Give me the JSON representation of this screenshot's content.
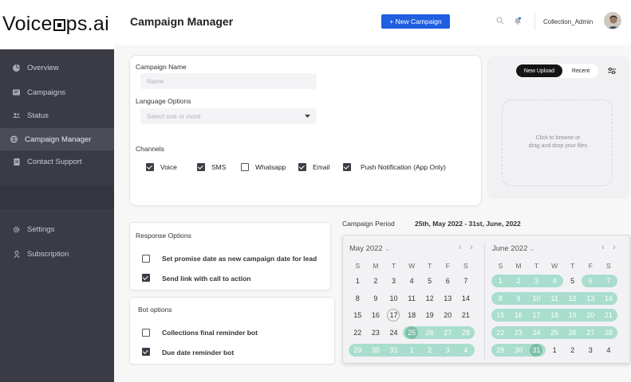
{
  "app": {
    "logo": "Voice▣ps.ai",
    "logo_left": "Voice",
    "logo_right": "ps.ai"
  },
  "sidebar": {
    "items": [
      {
        "label": "Overview",
        "icon": "pie-chart-icon"
      },
      {
        "label": "Campaigns",
        "icon": "campaign-icon"
      },
      {
        "label": "Status",
        "icon": "users-icon"
      },
      {
        "label": "Campaign Manager",
        "icon": "globe-icon",
        "active": true
      },
      {
        "label": "Contact Support",
        "icon": "document-icon"
      },
      {
        "label": "Settings",
        "icon": "gear-icon"
      },
      {
        "label": "Subscription",
        "icon": "user-icon"
      }
    ]
  },
  "header": {
    "title": "Campaign Manager",
    "new_campaign_label": "+ New Campaign",
    "user_name": "Collection_Admin"
  },
  "form": {
    "campaign_name_label": "Campaign Name",
    "name_placeholder": "Name",
    "language_label": "Language Options",
    "language_placeholder": "Select one or more",
    "channels_label": "Channels",
    "channels": [
      {
        "label": "Voice",
        "checked": true
      },
      {
        "label": "SMS",
        "checked": true
      },
      {
        "label": "Whatsapp",
        "checked": false
      },
      {
        "label": "Email",
        "checked": true
      },
      {
        "label": "Push Notification (App Only)",
        "checked": true
      }
    ]
  },
  "upload": {
    "tab_new": "New Upload",
    "tab_recent": "Recent",
    "drop_line1": "Click to browse or",
    "drop_line2": "drag and drop your files"
  },
  "response": {
    "title": "Response Options",
    "options": [
      {
        "label": "Set promise date as new campaign date for lead",
        "checked": false
      },
      {
        "label": "Send link with call to action",
        "checked": true
      }
    ]
  },
  "bot": {
    "title": "Bot options",
    "options": [
      {
        "label": "Collections final reminder bot",
        "checked": false
      },
      {
        "label": "Due date reminder bot",
        "checked": true
      }
    ]
  },
  "campaign_period": {
    "label": "Campaign Period",
    "value": "25th, May 2022 - 31st, June, 2022"
  },
  "calendar": {
    "weekdays": [
      "S",
      "M",
      "T",
      "W",
      "T",
      "F",
      "S"
    ],
    "months": [
      {
        "title": "May 2022",
        "rows": [
          [
            "1",
            "2",
            "3",
            "4",
            "5",
            "6",
            "7"
          ],
          [
            "8",
            "9",
            "10",
            "11",
            "12",
            "13",
            "14"
          ],
          [
            "15",
            "16",
            "17",
            "18",
            "19",
            "20",
            "21"
          ],
          [
            "22",
            "23",
            "24",
            "25",
            "26",
            "27",
            "28"
          ],
          [
            "29",
            "30",
            "31",
            "1",
            "2",
            "3",
            "4"
          ]
        ],
        "today": [
          2,
          2
        ],
        "range_start": [
          3,
          3
        ],
        "range_cells": [
          [
            3,
            3
          ],
          [
            3,
            4
          ],
          [
            3,
            5
          ],
          [
            3,
            6
          ],
          [
            4,
            0
          ],
          [
            4,
            1
          ],
          [
            4,
            2
          ],
          [
            4,
            3
          ],
          [
            4,
            4
          ],
          [
            4,
            5
          ],
          [
            4,
            6
          ]
        ]
      },
      {
        "title": "June 2022",
        "rows": [
          [
            "1",
            "2",
            "3",
            "4",
            "5",
            "6",
            "7"
          ],
          [
            "8",
            "9",
            "10",
            "11",
            "12",
            "13",
            "14"
          ],
          [
            "15",
            "16",
            "17",
            "18",
            "19",
            "20",
            "21"
          ],
          [
            "22",
            "23",
            "24",
            "25",
            "26",
            "27",
            "28"
          ],
          [
            "29",
            "30",
            "31",
            "1",
            "2",
            "3",
            "4"
          ]
        ],
        "range_end": [
          4,
          2
        ],
        "range_cells": [
          [
            0,
            0
          ],
          [
            0,
            1
          ],
          [
            0,
            2
          ],
          [
            0,
            3
          ],
          [
            0,
            5
          ],
          [
            0,
            6
          ],
          [
            1,
            0
          ],
          [
            1,
            1
          ],
          [
            1,
            2
          ],
          [
            1,
            3
          ],
          [
            1,
            4
          ],
          [
            1,
            5
          ],
          [
            1,
            6
          ],
          [
            2,
            0
          ],
          [
            2,
            1
          ],
          [
            2,
            2
          ],
          [
            2,
            3
          ],
          [
            2,
            4
          ],
          [
            2,
            5
          ],
          [
            2,
            6
          ],
          [
            3,
            0
          ],
          [
            3,
            1
          ],
          [
            3,
            2
          ],
          [
            3,
            3
          ],
          [
            3,
            4
          ],
          [
            3,
            5
          ],
          [
            3,
            6
          ],
          [
            4,
            0
          ],
          [
            4,
            1
          ],
          [
            4,
            2
          ]
        ]
      }
    ]
  },
  "colors": {
    "accent": "#1f5fe0",
    "sidebar": "#3a3b45",
    "range": "#a9ddcd",
    "range_edge": "#7dbfa8"
  }
}
